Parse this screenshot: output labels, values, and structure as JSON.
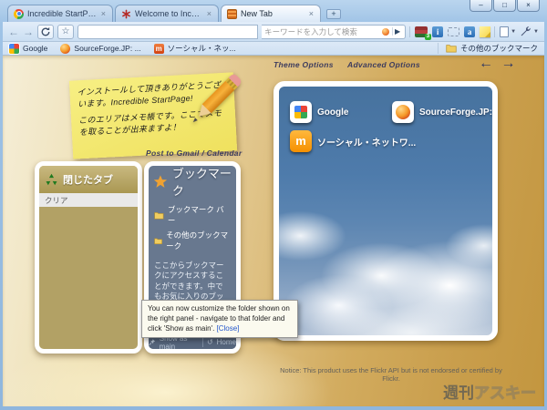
{
  "window": {
    "minimize": "–",
    "maximize": "□",
    "close": "×"
  },
  "tabs": [
    {
      "title": "Incredible StartPage -..."
    },
    {
      "title": "Welcome to Incredible..."
    },
    {
      "title": "New Tab"
    }
  ],
  "glyphs": {
    "tab_close": "×",
    "new_tab_plus": "+",
    "back": "←",
    "forward": "→",
    "go": "▶",
    "caret": "▼",
    "star": "☆",
    "home": "↺"
  },
  "toolbar": {
    "search_placeholder": "キーワードを入力して検索",
    "ext_badge": "3",
    "info_glyph": "i",
    "a_glyph": "a"
  },
  "bookmarks_bar": {
    "items": [
      {
        "label": "Google"
      },
      {
        "label": "SourceForge.JP: ..."
      },
      {
        "label": "ソーシャル・ネッ..."
      }
    ],
    "social_glyph": "m",
    "other_label": "その他のブックマーク"
  },
  "page": {
    "theme_options": "Theme Options",
    "advanced_options": "Advanced Options",
    "nav_arrows": "← →",
    "sticky_note": {
      "para1": "インストールして頂きありがとうございます。Incredible StartPage!",
      "para2": "このエリアはメモ帳です。ここでメモを取ることが出来ますよ！"
    },
    "closed_tabs": {
      "title": "閉じたタブ",
      "clear": "クリア"
    },
    "bookmarks_panel": {
      "heading": "Post to Gmail / Calendar",
      "title": "ブックマーク",
      "folder1": "ブックマーク バー",
      "folder2": "その他のブックマーク",
      "description": "ここからブックマークにアクセスすることができます。中でもお気に入りのブックマークはドラッグで右のエリアに表示ことができます。",
      "show_as_main": "Show as main",
      "home": "Home"
    },
    "tooltip": {
      "text": "You can now customize the folder shown on the right panel - navigate to that folder and click 'Show as main'. ",
      "close": "[Close]"
    },
    "speed_dial": {
      "items": [
        {
          "label": "Google"
        },
        {
          "label": "SourceForge.JP:..."
        },
        {
          "label": "ソーシャル・ネットワ..."
        }
      ],
      "mixi_glyph": "m"
    },
    "notice": "Notice: This product uses the Flickr API but is not endorsed or certified by Flickr.",
    "watermark": {
      "solid": "週刊",
      "outline": "アスキー"
    }
  },
  "colors": {
    "accent_gold": "#d2ab5e",
    "panel_slate": "#68788f",
    "panel_tan": "#b2a165",
    "note_yellow": "#f2e66e",
    "chrome_blue": "#9fc3e6"
  }
}
